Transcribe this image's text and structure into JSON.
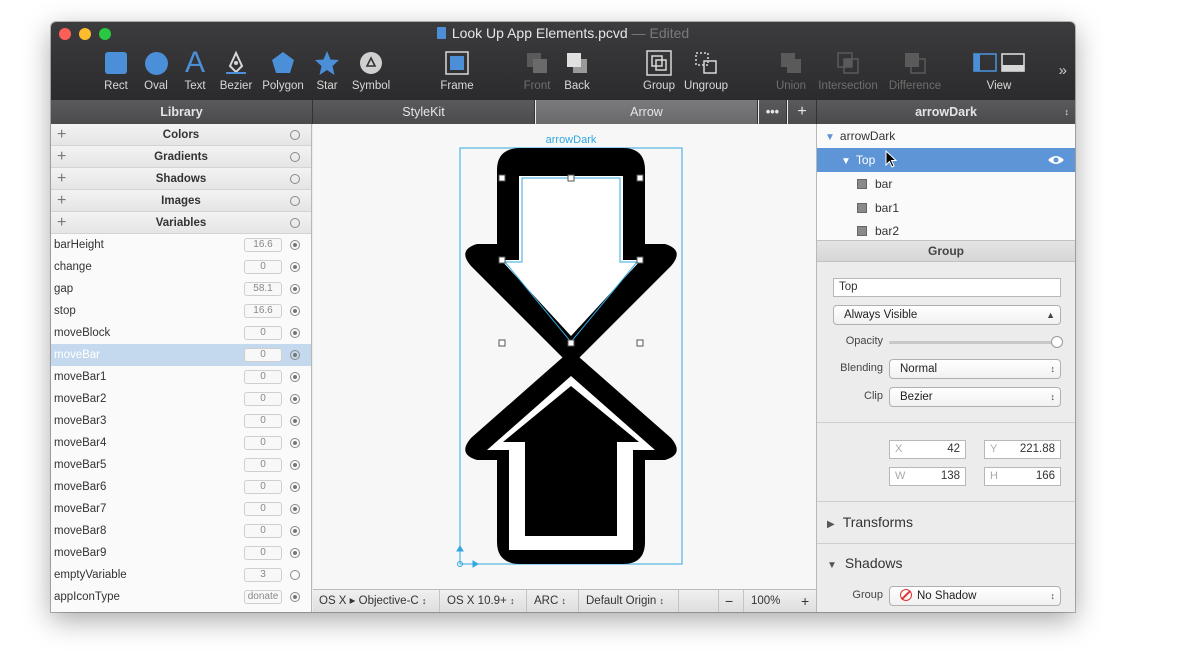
{
  "window": {
    "title": "Look Up App Elements.pcvd",
    "title_separator": "—",
    "title_status": "Edited"
  },
  "toolbar": {
    "tools": [
      {
        "label": "Rect",
        "icon": "rect-icon"
      },
      {
        "label": "Oval",
        "icon": "oval-icon"
      },
      {
        "label": "Text",
        "icon": "text-icon"
      },
      {
        "label": "Bezier",
        "icon": "bezier-pen-icon"
      },
      {
        "label": "Polygon",
        "icon": "polygon-icon"
      },
      {
        "label": "Star",
        "icon": "star-icon"
      },
      {
        "label": "Symbol",
        "icon": "symbol-icon"
      },
      {
        "label": "Frame",
        "icon": "frame-icon"
      },
      {
        "label": "Front",
        "icon": "front-icon"
      },
      {
        "label": "Back",
        "icon": "back-icon"
      },
      {
        "label": "Group",
        "icon": "group-icon"
      },
      {
        "label": "Ungroup",
        "icon": "ungroup-icon"
      },
      {
        "label": "Union",
        "icon": "union-icon"
      },
      {
        "label": "Intersection",
        "icon": "intersection-icon"
      },
      {
        "label": "Difference",
        "icon": "difference-icon"
      },
      {
        "label": "View",
        "icon": "view-icon"
      }
    ],
    "overflow": "»"
  },
  "library": {
    "header": "Library",
    "sections": [
      "Colors",
      "Gradients",
      "Shadows",
      "Images",
      "Variables"
    ],
    "variables": [
      {
        "name": "barHeight",
        "value": "16.6",
        "on": true
      },
      {
        "name": "change",
        "value": "0",
        "on": true
      },
      {
        "name": "gap",
        "value": "58.1",
        "on": true
      },
      {
        "name": "stop",
        "value": "16.6",
        "on": true
      },
      {
        "name": "moveBlock",
        "value": "0",
        "on": true
      },
      {
        "name": "moveBar",
        "value": "0",
        "on": true
      },
      {
        "name": "moveBar1",
        "value": "0",
        "on": true
      },
      {
        "name": "moveBar2",
        "value": "0",
        "on": true
      },
      {
        "name": "moveBar3",
        "value": "0",
        "on": true
      },
      {
        "name": "moveBar4",
        "value": "0",
        "on": true
      },
      {
        "name": "moveBar5",
        "value": "0",
        "on": true
      },
      {
        "name": "moveBar6",
        "value": "0",
        "on": true
      },
      {
        "name": "moveBar7",
        "value": "0",
        "on": true
      },
      {
        "name": "moveBar8",
        "value": "0",
        "on": true
      },
      {
        "name": "moveBar9",
        "value": "0",
        "on": true
      },
      {
        "name": "emptyVariable",
        "value": "3",
        "on": false
      },
      {
        "name": "appIconType",
        "value": "donate",
        "on": true
      }
    ]
  },
  "tabs": {
    "stylekit": "StyleKit",
    "arrow": "Arrow",
    "more": "•••",
    "add": "+"
  },
  "canvas": {
    "frame_label": "arrowDark"
  },
  "statusbar": {
    "platform": "OS X ▸ Objective-C",
    "version": "OS X 10.9+",
    "memory": "ARC",
    "origin": "Default Origin",
    "zoom_out": "−",
    "zoom": "100%",
    "zoom_in": "+"
  },
  "inspector": {
    "header": "arrowDark",
    "tree": {
      "root": "arrowDark",
      "selected": "Top",
      "children": [
        "bar",
        "bar1",
        "bar2"
      ]
    },
    "group_title": "Group",
    "name_value": "Top",
    "visibility": "Always Visible",
    "opacity_label": "Opacity",
    "opacity": 1.0,
    "blending_label": "Blending",
    "blending": "Normal",
    "clip_label": "Clip",
    "clip": "Bezier",
    "x_key": "X",
    "x": "42",
    "y_key": "Y",
    "y": "221.88",
    "w_key": "W",
    "w": "138",
    "h_key": "H",
    "h": "166",
    "transforms": "Transforms",
    "shadows": "Shadows",
    "shadow_group_label": "Group",
    "shadow_value": "No Shadow"
  },
  "colors": {
    "selection": "#5e95d6",
    "frame": "#31a8e0"
  }
}
